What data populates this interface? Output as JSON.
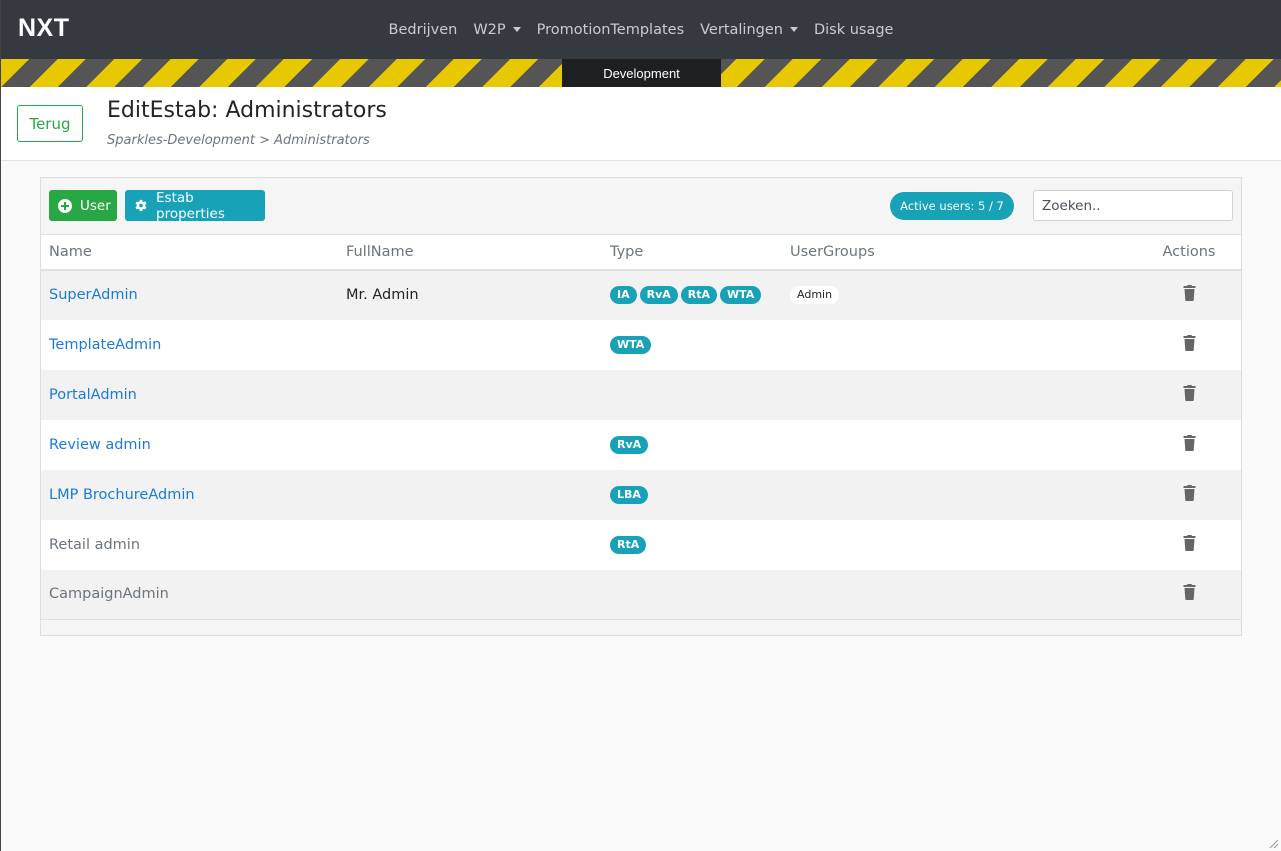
{
  "navbar": {
    "brand": "NXT",
    "items": [
      {
        "label": "Bedrijven",
        "dropdown": false
      },
      {
        "label": "W2P",
        "dropdown": true
      },
      {
        "label": "PromotionTemplates",
        "dropdown": false
      },
      {
        "label": "Vertalingen",
        "dropdown": true
      },
      {
        "label": "Disk usage",
        "dropdown": false
      }
    ]
  },
  "environment": "Development",
  "header": {
    "back_label": "Terug",
    "title": "EditEstab: Administrators",
    "breadcrumb": "Sparkles-Development > Administrators"
  },
  "toolbar": {
    "add_user_label": "User",
    "estab_properties_label": "Estab properties",
    "active_users": "Active users: 5 / 7",
    "search_placeholder": "Zoeken.."
  },
  "table": {
    "columns": [
      "Name",
      "FullName",
      "Type",
      "UserGroups",
      "Actions"
    ],
    "rows": [
      {
        "name": "SuperAdmin",
        "linked": true,
        "fullname": "Mr. Admin",
        "types": [
          "IA",
          "RvA",
          "RtA",
          "WTA"
        ],
        "groups": [
          "Admin"
        ]
      },
      {
        "name": "TemplateAdmin",
        "linked": true,
        "fullname": "",
        "types": [
          "WTA"
        ],
        "groups": []
      },
      {
        "name": "PortalAdmin",
        "linked": true,
        "fullname": "",
        "types": [],
        "groups": []
      },
      {
        "name": "Review admin",
        "linked": true,
        "fullname": "",
        "types": [
          "RvA"
        ],
        "groups": []
      },
      {
        "name": "LMP BrochureAdmin",
        "linked": true,
        "fullname": "",
        "types": [
          "LBA"
        ],
        "groups": []
      },
      {
        "name": "Retail admin",
        "linked": false,
        "fullname": "",
        "types": [
          "RtA"
        ],
        "groups": []
      },
      {
        "name": "CampaignAdmin",
        "linked": false,
        "fullname": "",
        "types": [],
        "groups": []
      }
    ]
  },
  "colors": {
    "navbar_bg": "#343a40",
    "success": "#28a745",
    "info": "#17a2b8",
    "link": "#1a7bd6",
    "stripe_yellow": "#e8c800"
  }
}
